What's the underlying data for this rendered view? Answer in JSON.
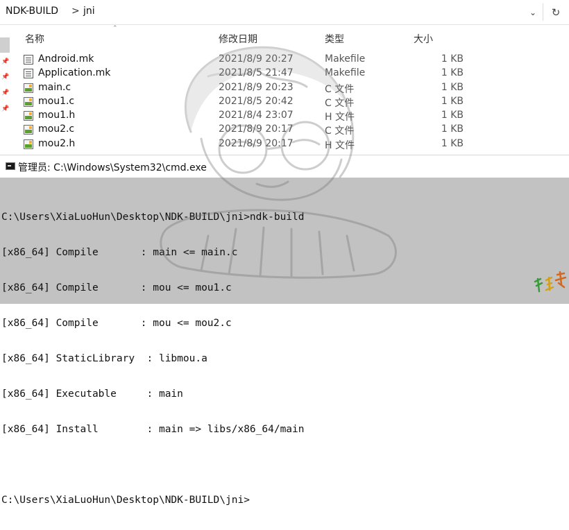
{
  "explorer": {
    "breadcrumb": [
      "NDK-BUILD",
      "jni"
    ],
    "breadcrumb_sep": ">",
    "dropdown_icon": "chevron-down",
    "refresh_icon": "refresh",
    "columns": {
      "name": "名称",
      "modified": "修改日期",
      "type": "类型",
      "size": "大小"
    },
    "files": [
      {
        "name": "Android.mk",
        "date": "2021/8/9 20:27",
        "type": "Makefile",
        "size": "1 KB",
        "icon": "makefile-icon"
      },
      {
        "name": "Application.mk",
        "date": "2021/8/5 21:47",
        "type": "Makefile",
        "size": "1 KB",
        "icon": "makefile-icon"
      },
      {
        "name": "main.c",
        "date": "2021/8/9 20:23",
        "type": "C 文件",
        "size": "1 KB",
        "icon": "c-file-icon"
      },
      {
        "name": "mou1.c",
        "date": "2021/8/5 20:42",
        "type": "C 文件",
        "size": "1 KB",
        "icon": "c-file-icon"
      },
      {
        "name": "mou1.h",
        "date": "2021/8/4 23:07",
        "type": "H 文件",
        "size": "1 KB",
        "icon": "h-file-icon"
      },
      {
        "name": "mou2.c",
        "date": "2021/8/9 20:17",
        "type": "C 文件",
        "size": "1 KB",
        "icon": "c-file-icon"
      },
      {
        "name": "mou2.h",
        "date": "2021/8/9 20:17",
        "type": "H 文件",
        "size": "1 KB",
        "icon": "h-file-icon"
      }
    ]
  },
  "cmd": {
    "title": "管理员: C:\\Windows\\System32\\cmd.exe",
    "lines": [
      "C:\\Users\\XiaLuoHun\\Desktop\\NDK-BUILD\\jni>ndk-build",
      "[x86_64] Compile       : main <= main.c",
      "[x86_64] Compile       : mou <= mou1.c",
      "[x86_64] Compile       : mou <= mou2.c",
      "[x86_64] StaticLibrary  : libmou.a",
      "[x86_64] Executable     : main",
      "[x86_64] Install        : main => libs/x86_64/main",
      "",
      "C:\\Users\\XiaLuoHun\\Desktop\\NDK-BUILD\\jni>"
    ]
  }
}
